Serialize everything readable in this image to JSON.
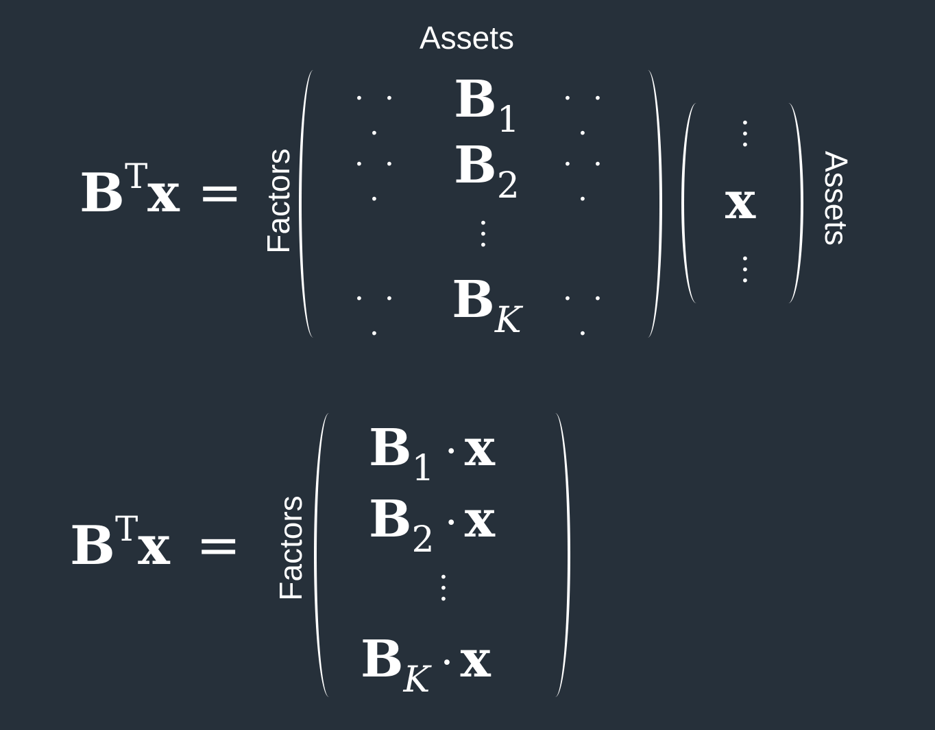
{
  "labels": {
    "assets_top": "Assets",
    "factors": "Factors",
    "assets_side": "Assets"
  },
  "equation1": {
    "lhs_B": "B",
    "lhs_T": "T",
    "lhs_x": "x",
    "equals": "=",
    "rows": [
      {
        "left": "· · ·",
        "B": "B",
        "sub": "1",
        "right": "· · ·"
      },
      {
        "left": "· · ·",
        "B": "B",
        "sub": "2",
        "right": "· · ·"
      },
      {
        "left": "· · ·",
        "B": "B",
        "sub": "K",
        "right": "· · ·"
      }
    ],
    "vector_x": "x"
  },
  "equation2": {
    "lhs_B": "B",
    "lhs_T": "T",
    "lhs_x": "x",
    "equals": "=",
    "rows": [
      {
        "B": "B",
        "sub": "1",
        "dot": "·",
        "x": "x"
      },
      {
        "B": "B",
        "sub": "2",
        "dot": "·",
        "x": "x"
      },
      {
        "B": "B",
        "sub": "K",
        "dot": "·",
        "x": "x"
      }
    ]
  },
  "colors": {
    "background": "#26303a",
    "foreground": "#ffffff"
  }
}
